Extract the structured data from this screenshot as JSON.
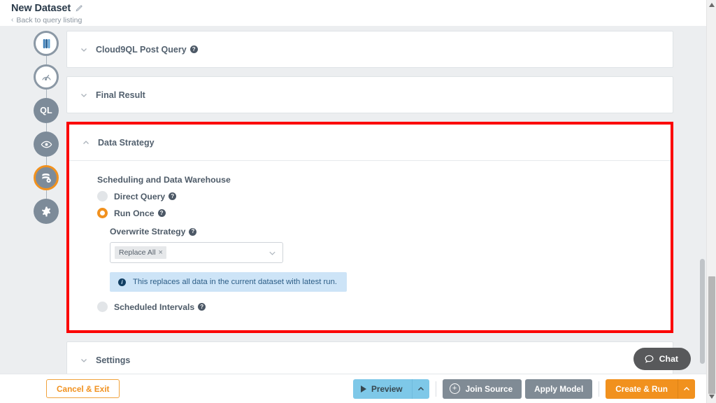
{
  "header": {
    "title": "New Dataset",
    "edit_icon": "pencil-icon",
    "back_link": "Back to query listing",
    "back_chevron": "‹"
  },
  "stepper": {
    "items": [
      {
        "name": "data-source-step",
        "icon": "database-icon",
        "label": "",
        "state": "ring"
      },
      {
        "name": "query-step",
        "icon": "gauge-icon",
        "label": "",
        "state": "ring"
      },
      {
        "name": "cloud9ql-step",
        "icon": "text-label",
        "label": "QL",
        "state": "filled"
      },
      {
        "name": "preview-step",
        "icon": "eye-icon",
        "label": "",
        "state": "filled"
      },
      {
        "name": "data-strategy-step",
        "icon": "database-gear-icon",
        "label": "",
        "state": "active"
      },
      {
        "name": "settings-step",
        "icon": "gear-icon",
        "label": "",
        "state": "filled"
      }
    ]
  },
  "panels": {
    "post_query": {
      "title": "Cloud9QL Post Query",
      "help": "?",
      "chevron": "down",
      "has_help": true
    },
    "final_result": {
      "title": "Final Result",
      "chevron": "down",
      "has_help": false
    },
    "data_strategy": {
      "title": "Data Strategy",
      "chevron": "up",
      "has_help": false
    },
    "settings": {
      "title": "Settings",
      "chevron": "down",
      "has_help": false
    }
  },
  "data_strategy": {
    "section_label": "Scheduling and Data Warehouse",
    "options": [
      {
        "label": "Direct Query",
        "selected": false,
        "help": "?"
      },
      {
        "label": "Run Once",
        "selected": true,
        "help": "?"
      },
      {
        "label": "Scheduled Intervals",
        "selected": false,
        "help": "?"
      }
    ],
    "overwrite": {
      "label": "Overwrite Strategy",
      "help": "?",
      "selected_chip": "Replace All",
      "chip_remove": "×",
      "caret": "chevron-down"
    },
    "info_message": "This replaces all data in the current dataset with latest run.",
    "info_badge": "i"
  },
  "bottom_bar": {
    "cancel": "Cancel & Exit",
    "preview": "Preview",
    "preview_caret": "^",
    "join_source": "Join Source",
    "join_plus": "+",
    "apply_model": "Apply Model",
    "create_run": "Create & Run",
    "create_caret": "^"
  },
  "chat": {
    "label": "Chat",
    "icon": "chat-bubble-icon"
  },
  "colors": {
    "accent_orange": "#f1911e",
    "highlight_red": "#fb0000",
    "info_blue_bg": "#cde4f7",
    "info_blue_text": "#2c5d86",
    "preview_blue": "#7ec8e8",
    "grey_button": "#808b95"
  }
}
